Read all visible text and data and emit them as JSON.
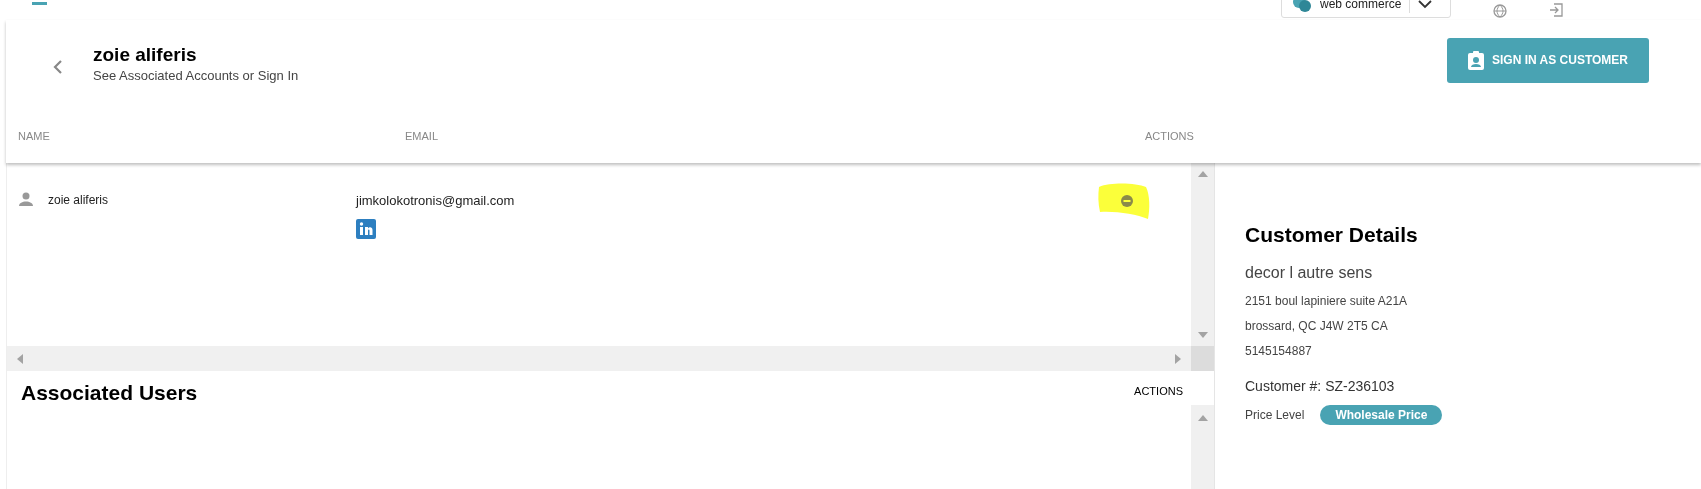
{
  "top_bar": {
    "store_selector": "web commerce"
  },
  "header": {
    "title": "zoie aliferis",
    "subtitle": "See Associated Accounts or Sign In",
    "button": "SIGN IN AS CUSTOMER"
  },
  "table": {
    "columns": [
      "NAME",
      "EMAIL",
      "ACTIONS"
    ],
    "rows": [
      {
        "name": "zoie aliferis",
        "email": "jimkolokotronis@gmail.com",
        "highlighted": true
      }
    ]
  },
  "associated_users": {
    "title": "Associated Users",
    "actions_label": "ACTIONS"
  },
  "customer_details": {
    "title": "Customer Details",
    "company": "decor l autre sens",
    "address_lines": [
      "2151 boul lapiniere suite A21A",
      "brossard, QC J4W 2T5 CA",
      "5145154887"
    ],
    "customer_number": "Customer #: SZ-236103",
    "price_level_label": "Price Level",
    "price_level": "Wholesale Price"
  }
}
